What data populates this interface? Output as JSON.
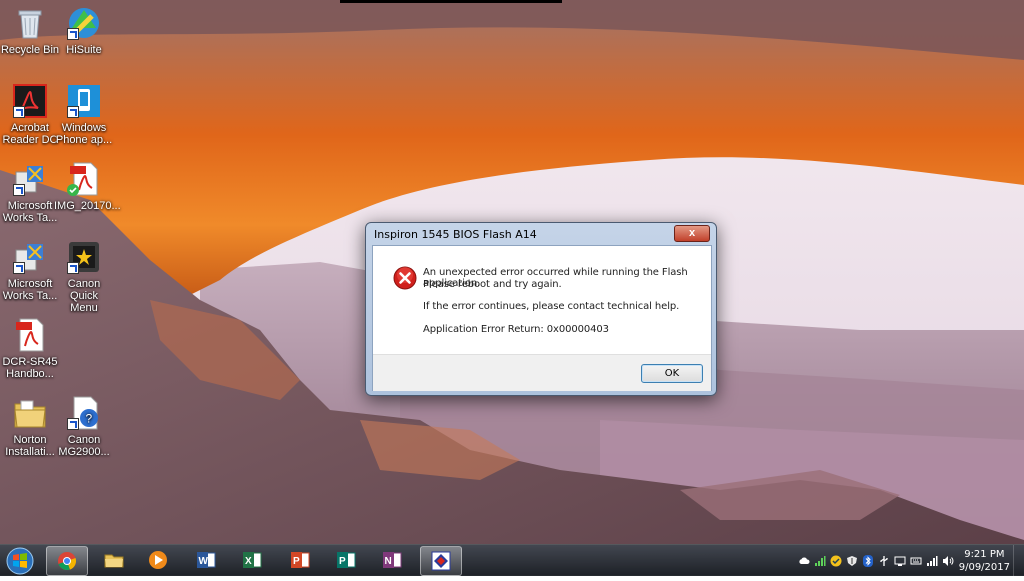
{
  "desktop": {
    "icons": [
      {
        "label": "Recycle Bin"
      },
      {
        "label": "HiSuite"
      },
      {
        "label": "Acrobat\nReader DC"
      },
      {
        "label": "Windows\nPhone ap..."
      },
      {
        "label": "Microsoft\nWorks Ta..."
      },
      {
        "label": "IMG_20170..."
      },
      {
        "label": "Microsoft\nWorks Ta..."
      },
      {
        "label": "Canon Quick\nMenu"
      },
      {
        "label": "DCR-SR45\nHandbo..."
      },
      {
        "label": "Norton\nInstallati..."
      },
      {
        "label": "Canon\nMG2900..."
      }
    ]
  },
  "dialog": {
    "title": "Inspiron 1545 BIOS Flash A14",
    "close_label": "x",
    "line1": "An unexpected error occurred while running the Flash application.",
    "line2": "Please reboot and try again.",
    "line3": "If the error continues, please contact technical help.",
    "line4": "Application Error Return: 0x00000403",
    "ok_label": "OK"
  },
  "taskbar": {
    "apps": [
      "start",
      "chrome",
      "file-explorer",
      "media-player",
      "word",
      "excel",
      "powerpoint",
      "publisher",
      "onenote",
      "bios-flash"
    ],
    "time": "9:21 PM",
    "date": "9/09/2017"
  },
  "colors": {
    "taskbar": "#1e242b",
    "dialog_frame": "#b9cbe2",
    "error_red": "#d0201c"
  }
}
